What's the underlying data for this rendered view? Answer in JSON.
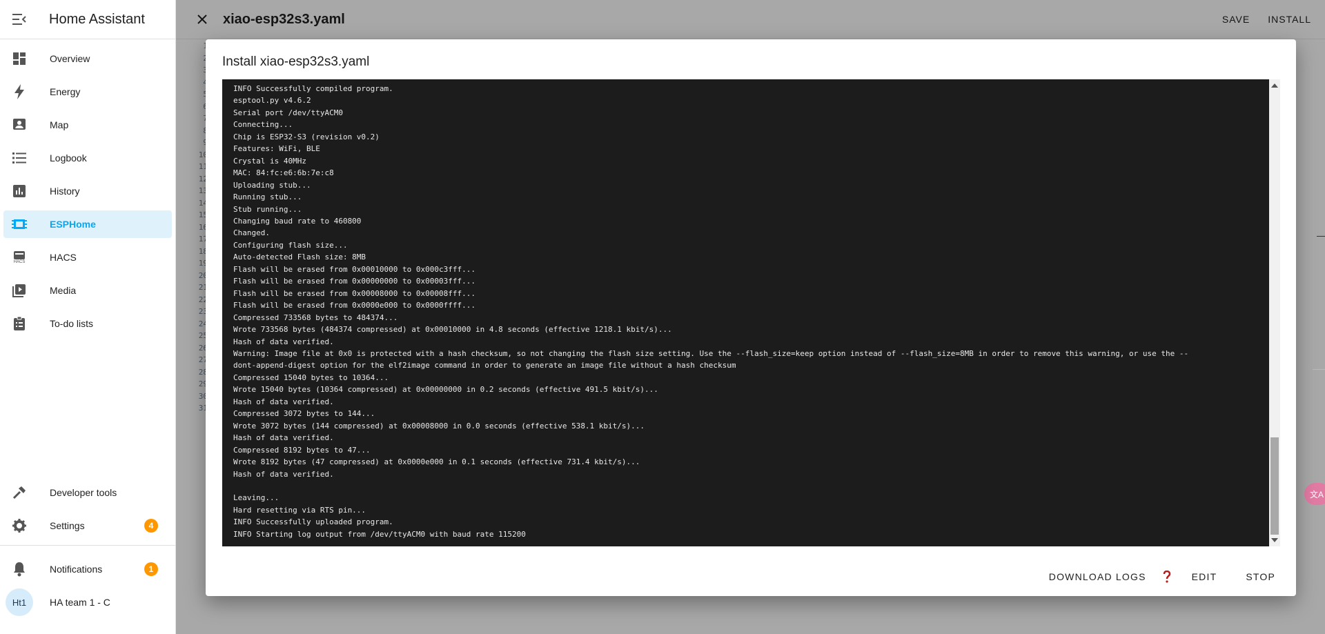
{
  "sidebar": {
    "title": "Home Assistant",
    "items": [
      {
        "label": "Overview",
        "icon": "dashboard-icon"
      },
      {
        "label": "Energy",
        "icon": "lightning-bolt-icon"
      },
      {
        "label": "Map",
        "icon": "map-person-icon"
      },
      {
        "label": "Logbook",
        "icon": "list-icon"
      },
      {
        "label": "History",
        "icon": "chart-box-icon"
      },
      {
        "label": "ESPHome",
        "icon": "chip-icon",
        "active": true
      },
      {
        "label": "HACS",
        "icon": "hacs-icon",
        "icon_text": "HACS"
      },
      {
        "label": "Media",
        "icon": "play-box-icon"
      },
      {
        "label": "To-do lists",
        "icon": "clipboard-list-icon"
      }
    ],
    "developer_tools": "Developer tools",
    "settings": {
      "label": "Settings",
      "badge": "4"
    },
    "notifications": {
      "label": "Notifications",
      "badge": "1"
    },
    "user": {
      "initials": "Ht1",
      "name": "HA team 1 - C"
    }
  },
  "editor": {
    "title": "xiao-esp32s3.yaml",
    "save_label": "SAVE",
    "install_label": "INSTALL",
    "line_numbers": [
      "1",
      "2",
      "3",
      "4",
      "5",
      "6",
      "7",
      "8",
      "9",
      "10",
      "11",
      "12",
      "13",
      "14",
      "15",
      "16",
      "17",
      "18",
      "19",
      "20",
      "21",
      "22",
      "23",
      "24",
      "25",
      "26",
      "27",
      "28",
      "29",
      "30",
      "31"
    ]
  },
  "dialog": {
    "title": "Install xiao-esp32s3.yaml",
    "log_lines": [
      "INFO Successfully compiled program.",
      "esptool.py v4.6.2",
      "Serial port /dev/ttyACM0",
      "Connecting...",
      "Chip is ESP32-S3 (revision v0.2)",
      "Features: WiFi, BLE",
      "Crystal is 40MHz",
      "MAC: 84:fc:e6:6b:7e:c8",
      "Uploading stub...",
      "Running stub...",
      "Stub running...",
      "Changing baud rate to 460800",
      "Changed.",
      "Configuring flash size...",
      "Auto-detected Flash size: 8MB",
      "Flash will be erased from 0x00010000 to 0x000c3fff...",
      "Flash will be erased from 0x00000000 to 0x00003fff...",
      "Flash will be erased from 0x00008000 to 0x00008fff...",
      "Flash will be erased from 0x0000e000 to 0x0000ffff...",
      "Compressed 733568 bytes to 484374...",
      "Wrote 733568 bytes (484374 compressed) at 0x00010000 in 4.8 seconds (effective 1218.1 kbit/s)...",
      "Hash of data verified.",
      "Warning: Image file at 0x0 is protected with a hash checksum, so not changing the flash size setting. Use the --flash_size=keep option instead of --flash_size=8MB in order to remove this warning, or use the --",
      "dont-append-digest option for the elf2image command in order to generate an image file without a hash checksum",
      "Compressed 15040 bytes to 10364...",
      "Wrote 15040 bytes (10364 compressed) at 0x00000000 in 0.2 seconds (effective 491.5 kbit/s)...",
      "Hash of data verified.",
      "Compressed 3072 bytes to 144...",
      "Wrote 3072 bytes (144 compressed) at 0x00008000 in 0.0 seconds (effective 538.1 kbit/s)...",
      "Hash of data verified.",
      "Compressed 8192 bytes to 47...",
      "Wrote 8192 bytes (47 compressed) at 0x0000e000 in 0.1 seconds (effective 731.4 kbit/s)...",
      "Hash of data verified.",
      "",
      "Leaving...",
      "Hard resetting via RTS pin...",
      "INFO Successfully uploaded program.",
      "INFO Starting log output from /dev/ttyACM0 with baud rate 115200"
    ],
    "download_logs_label": "DOWNLOAD LOGS",
    "edit_label": "EDIT",
    "stop_label": "STOP"
  },
  "colors": {
    "accent": "#03a9f4",
    "active_bg": "#dff1fa",
    "badge": "#ff9800",
    "console_bg": "#1c1c1c",
    "help_icon": "#b71c1c"
  }
}
